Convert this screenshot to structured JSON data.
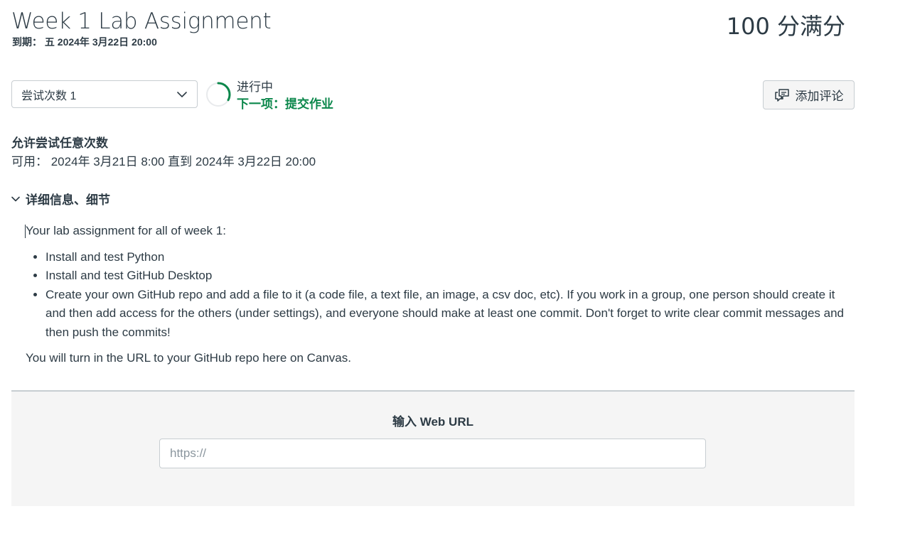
{
  "assignment": {
    "title": "Week 1 Lab Assignment",
    "due": "到期： 五 2024年 3月22日 20:00",
    "points": "100 分满分"
  },
  "attempt": {
    "selected": "尝试次数 1",
    "status": "进行中",
    "next_step": "下一项：提交作业",
    "progress_fraction": 0.33
  },
  "comment_button": {
    "label": "添加评论",
    "icon": "comment-icon"
  },
  "availability": {
    "allowed": "允许尝试任意次数",
    "available": "可用：  2024年 3月21日 8:00 直到 2024年 3月22日 20:00"
  },
  "details": {
    "toggle_label": "详细信息、细节",
    "intro": "Your lab assignment for all of week 1:",
    "items": [
      "Install and test Python",
      "Install and test GitHub Desktop",
      "Create your own GitHub repo and add a file to it (a code file, a text file, an image, a csv doc, etc).  If you work in a group, one person should create it and then add access for the others (under settings), and everyone should make at least one commit.  Don't forget to write clear commit messages and then push the commits!"
    ],
    "outro": "You will turn in the URL to your GitHub repo here on Canvas."
  },
  "submission": {
    "label": "输入 Web URL",
    "placeholder": "https://",
    "value": ""
  },
  "colors": {
    "text": "#2d3b45",
    "success": "#0b874b",
    "border": "#c7cdd1",
    "panel_bg": "#f5f5f5"
  }
}
